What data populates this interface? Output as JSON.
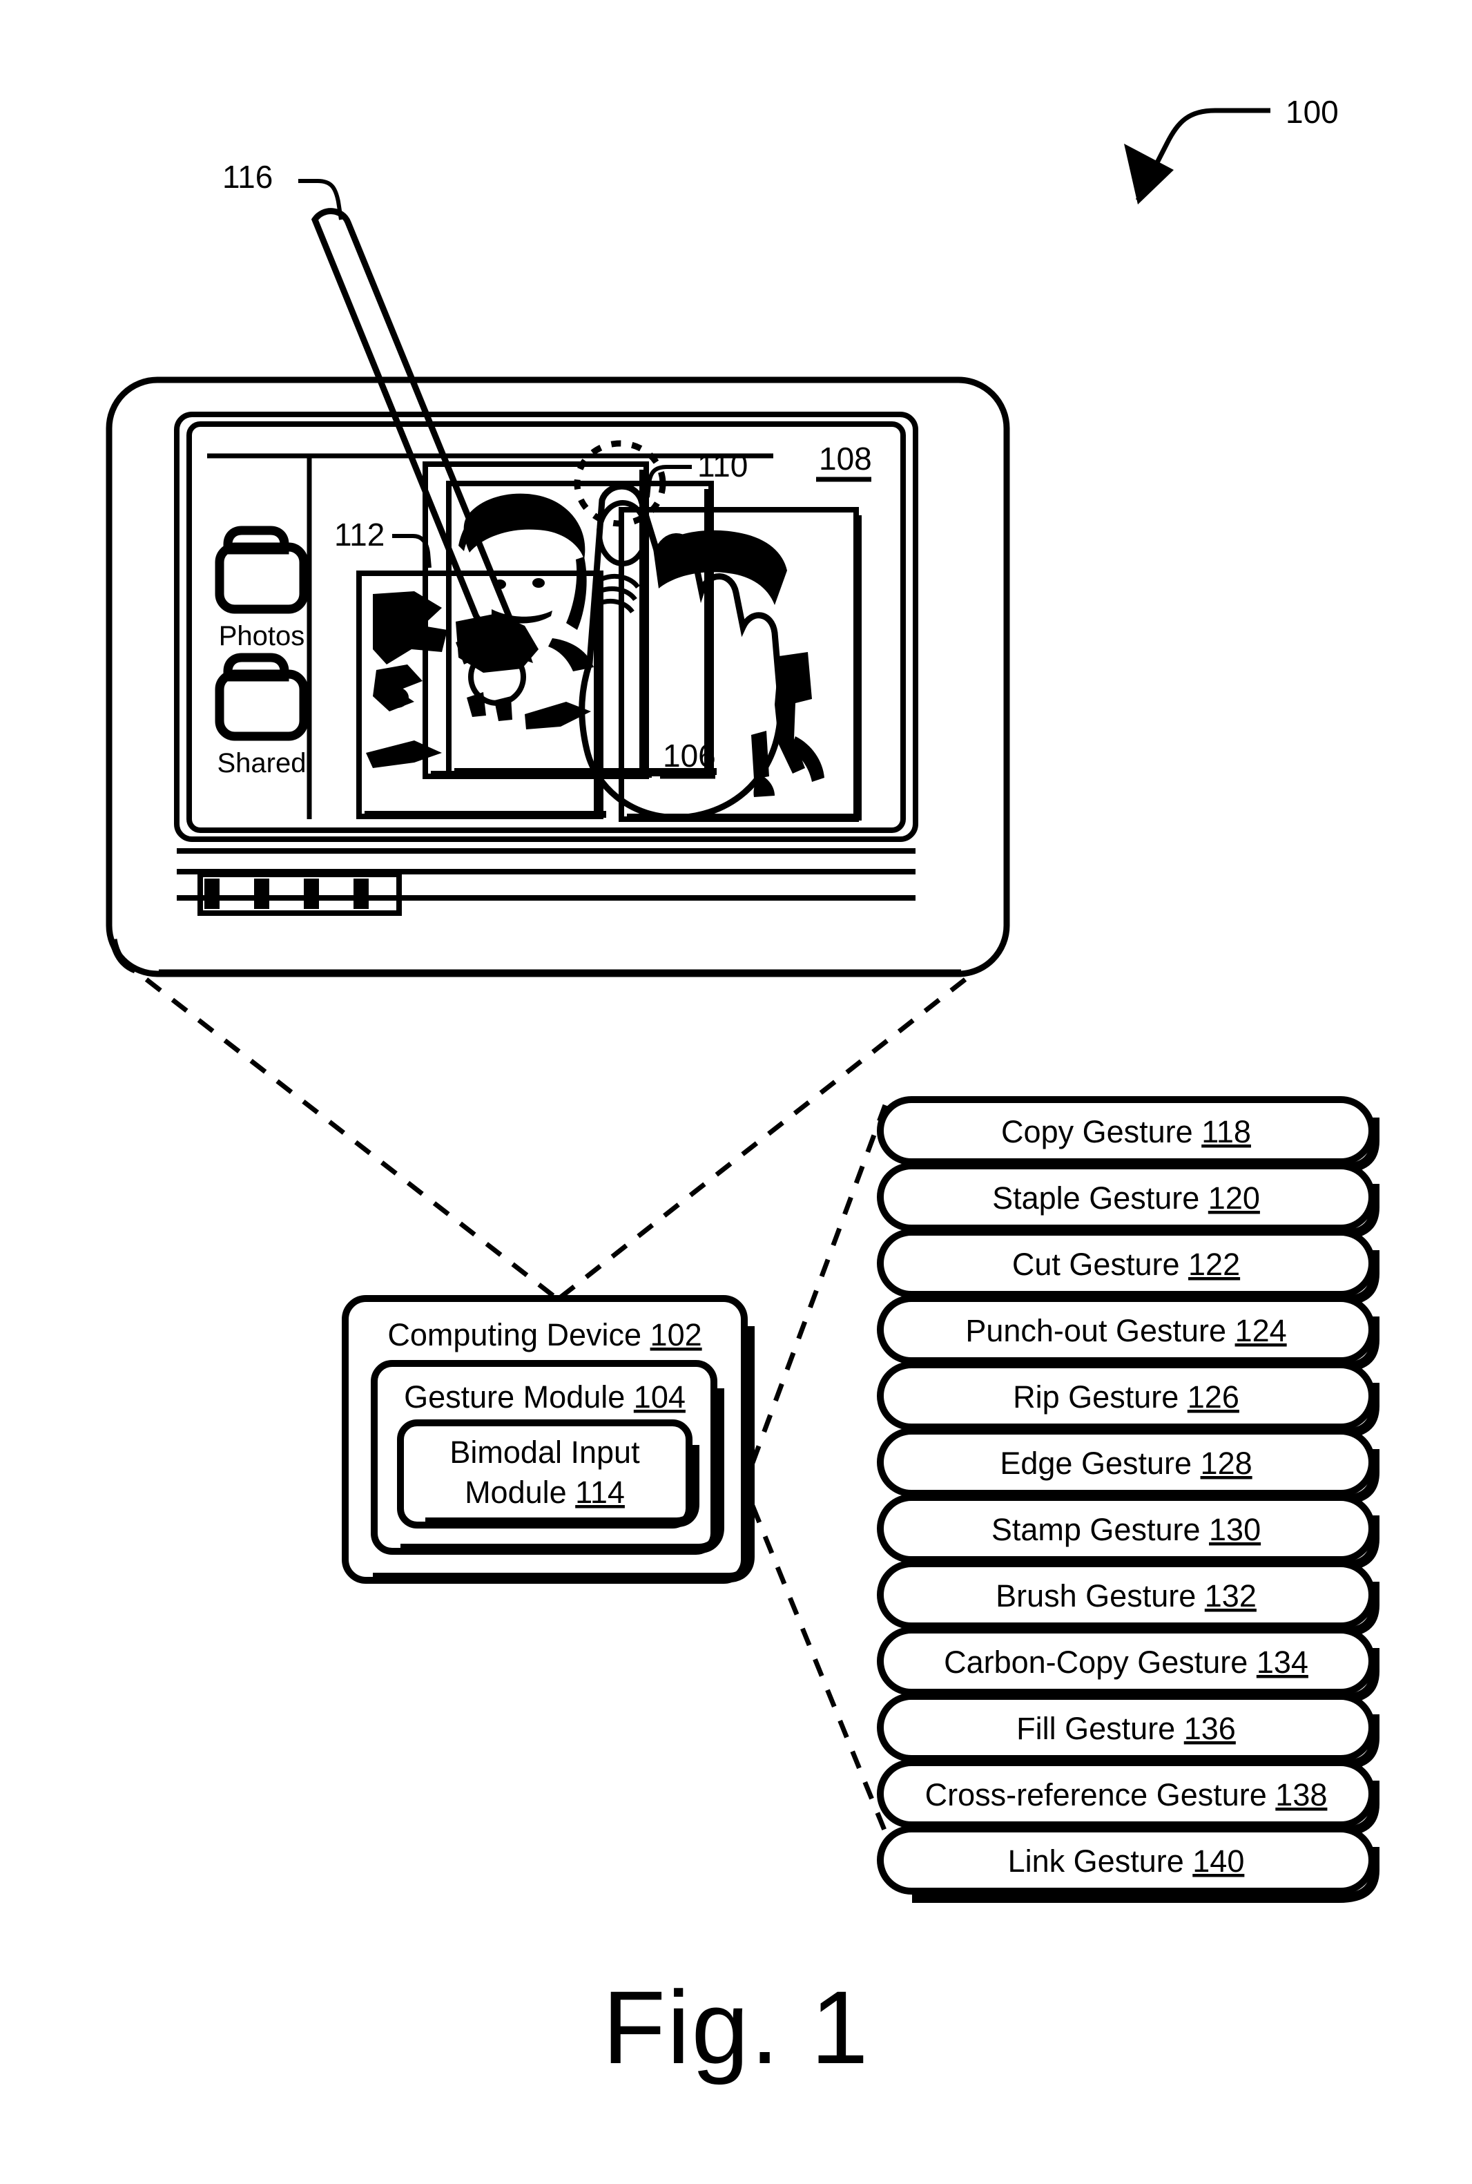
{
  "figure": {
    "caption": "Fig. 1",
    "system_ref": "100"
  },
  "device": {
    "display_ref": "108",
    "hand_ref": "106",
    "contact_area_ref": "110",
    "image_ref": "112",
    "stylus_ref": "116",
    "sidebar": {
      "items": [
        {
          "icon": "folder-icon",
          "label": "Photos"
        },
        {
          "icon": "folder-icon",
          "label": "Shared"
        }
      ]
    },
    "toolbar": {
      "button_count": 4
    }
  },
  "blocks": {
    "computing_device": {
      "label": "Computing Device",
      "ref": "102"
    },
    "gesture_module": {
      "label": "Gesture Module",
      "ref": "104"
    },
    "bimodal_input_module": {
      "label_line1": "Bimodal Input",
      "label_line2": "Module",
      "ref": "114"
    }
  },
  "gestures": [
    {
      "label": "Copy Gesture",
      "ref": "118"
    },
    {
      "label": "Staple Gesture",
      "ref": "120"
    },
    {
      "label": "Cut Gesture",
      "ref": "122"
    },
    {
      "label": "Punch-out Gesture",
      "ref": "124"
    },
    {
      "label": "Rip Gesture",
      "ref": "126"
    },
    {
      "label": "Edge Gesture",
      "ref": "128"
    },
    {
      "label": "Stamp Gesture",
      "ref": "130"
    },
    {
      "label": "Brush Gesture",
      "ref": "132"
    },
    {
      "label": "Carbon-Copy Gesture",
      "ref": "134"
    },
    {
      "label": "Fill Gesture",
      "ref": "136"
    },
    {
      "label": "Cross-reference Gesture",
      "ref": "138"
    },
    {
      "label": "Link Gesture",
      "ref": "140"
    }
  ],
  "colors": {
    "ink": "#000000",
    "paper": "#ffffff"
  }
}
